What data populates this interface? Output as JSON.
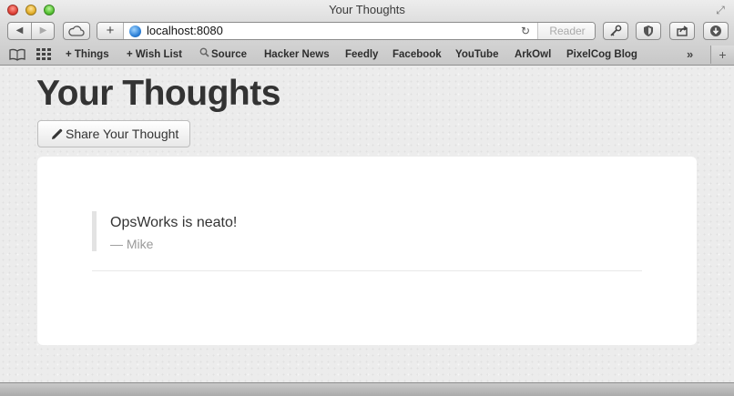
{
  "window": {
    "title": "Your Thoughts"
  },
  "toolbar": {
    "back_glyph": "◀",
    "forward_glyph": "▶",
    "add_glyph": "+",
    "url": "localhost:8080",
    "reload_glyph": "↻",
    "reader_label": "Reader"
  },
  "bookmarks": {
    "items": [
      "+ Things",
      "+ Wish List",
      "Source",
      "Hacker News",
      "Feedly",
      "Facebook",
      "YouTube",
      "ArkOwl",
      "PixelCog Blog"
    ],
    "more_glyph": "»",
    "new_tab_glyph": "+"
  },
  "page": {
    "title": "Your Thoughts",
    "share_button_label": "Share Your Thought",
    "thoughts": [
      {
        "text": "OpsWorks is neato!",
        "author": "— Mike"
      }
    ]
  },
  "colors": {
    "page_background": "#ececec",
    "card_background": "#ffffff",
    "title_text": "#333333",
    "author_text": "#9a9a9a",
    "quote_border": "#e3e3e3"
  },
  "icons": [
    "close-icon",
    "minimize-icon",
    "zoom-icon",
    "fullscreen-icon",
    "back-icon",
    "forward-icon",
    "icloud-icon",
    "add-icon",
    "globe-icon",
    "reload-icon",
    "key-icon",
    "shield-icon",
    "share-icon",
    "download-icon",
    "reading-list-icon",
    "top-sites-icon",
    "search-icon",
    "pencil-icon"
  ]
}
